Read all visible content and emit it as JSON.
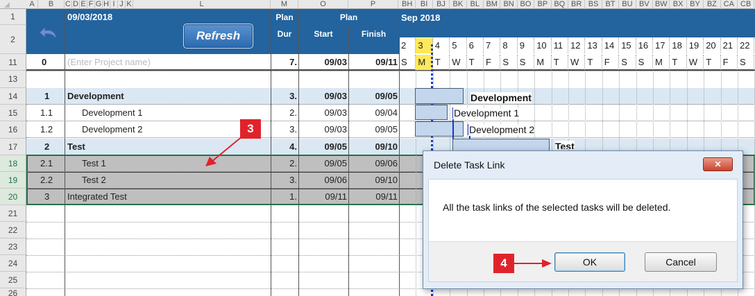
{
  "column_headers": [
    "A",
    "B",
    "C",
    "D",
    "E",
    "F",
    "G",
    "H",
    "I",
    "J",
    "K",
    "L",
    "M",
    "O",
    "P",
    "BH",
    "BI",
    "BJ",
    "BK",
    "BL",
    "BM",
    "BN",
    "BO",
    "BP",
    "BQ",
    "BR",
    "BS",
    "BT",
    "BU",
    "BV",
    "BW",
    "BX",
    "BY",
    "BZ",
    "CA",
    "CB"
  ],
  "row_headers": [
    "1",
    "2",
    "11",
    "13",
    "14",
    "15",
    "16",
    "17",
    "18",
    "19",
    "20",
    "21",
    "22",
    "23",
    "24",
    "25",
    "26"
  ],
  "header": {
    "date": "09/03/2018",
    "refresh_label": "Refresh",
    "plan_dur_line1": "Plan",
    "plan_dur_line2": "Dur",
    "plan_label": "Plan",
    "start_label": "Start",
    "finish_label": "Finish",
    "month_label": "Sep 2018",
    "days": [
      "2",
      "3",
      "4",
      "5",
      "6",
      "7",
      "8",
      "9",
      "10",
      "11",
      "12",
      "13",
      "14",
      "15",
      "16",
      "17",
      "18",
      "19",
      "20",
      "21",
      "22"
    ]
  },
  "project_row": {
    "id": "0",
    "name_placeholder": "(Enter Project name)",
    "dur": "7.",
    "start": "09/03",
    "finish": "09/11",
    "weekdays": [
      "S",
      "M",
      "T",
      "W",
      "T",
      "F",
      "S",
      "S",
      "M",
      "T",
      "W",
      "T",
      "F",
      "S",
      "S",
      "M",
      "T",
      "W",
      "T",
      "F",
      "S"
    ]
  },
  "tasks": [
    {
      "id": "1",
      "name": "Development",
      "dur": "3.",
      "start": "09/03",
      "finish": "09/05"
    },
    {
      "id": "1.1",
      "name": "Development 1",
      "dur": "2.",
      "start": "09/03",
      "finish": "09/04"
    },
    {
      "id": "1.2",
      "name": "Development 2",
      "dur": "3.",
      "start": "09/03",
      "finish": "09/05"
    },
    {
      "id": "2",
      "name": "Test",
      "dur": "4.",
      "start": "09/05",
      "finish": "09/10"
    },
    {
      "id": "2.1",
      "name": "Test 1",
      "dur": "2.",
      "start": "09/05",
      "finish": "09/06"
    },
    {
      "id": "2.2",
      "name": "Test 2",
      "dur": "3.",
      "start": "09/06",
      "finish": "09/10"
    },
    {
      "id": "3",
      "name": "Integrated Test",
      "dur": "1.",
      "start": "09/11",
      "finish": "09/11"
    }
  ],
  "gantt_labels": {
    "development": "Development",
    "development1": "Development 1",
    "development2": "Development 2",
    "test": "Test"
  },
  "callouts": {
    "step3": "3",
    "step4": "4"
  },
  "dialog": {
    "title": "Delete Task Link",
    "close_symbol": "✕",
    "message": "All the task links of the selected tasks will be deleted.",
    "ok_label": "OK",
    "cancel_label": "Cancel"
  },
  "colors": {
    "header_band": "#23639e",
    "selected_rows": "#bfbfbf",
    "summary_rows": "#dbe8f3",
    "today_line": "#1a37c8",
    "callout": "#e0232a"
  }
}
